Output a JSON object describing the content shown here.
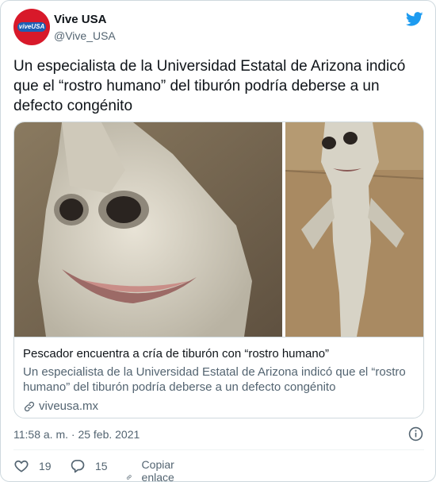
{
  "account": {
    "name": "Vive USA",
    "handle": "@Vive_USA",
    "avatar_text": "viveUSA"
  },
  "tweet": {
    "text": "Un especialista de la Universidad Estatal de Arizona indicó que el “rostro humano” del tiburón podría deberse a un defecto congénito",
    "timestamp": "11:58 a. m. · 25 feb. 2021"
  },
  "card": {
    "title": "Pescador encuentra a cría de tiburón con “rostro humano”",
    "description": "Un especialista de la Universidad Estatal de Arizona indicó que el “rostro humano” del tiburón podría deberse a un defecto congénito",
    "domain": "viveusa.mx"
  },
  "actions": {
    "likes": "19",
    "replies": "15",
    "copy_link": "Copiar enlace al Tweet"
  },
  "icons": {
    "twitter": "twitter-bird-icon",
    "info": "info-icon",
    "like": "heart-icon",
    "reply": "reply-icon",
    "link": "link-icon"
  },
  "colors": {
    "twitter_blue": "#1d9bf0",
    "text_secondary": "#536471",
    "avatar_red": "#d8192a"
  }
}
